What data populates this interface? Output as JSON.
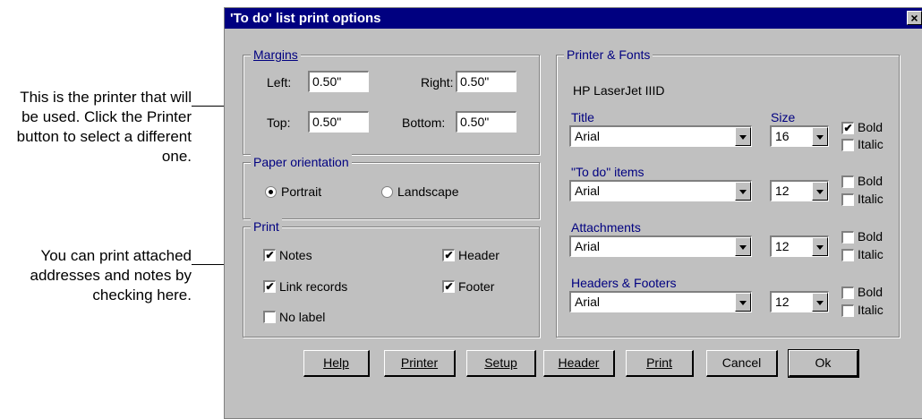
{
  "callouts": {
    "printer": "This is the printer that will be used. Click the Printer button to select a different one.",
    "attached": "You can print attached addresses and notes by checking here."
  },
  "dialog": {
    "title": "'To do' list print options",
    "close": "×"
  },
  "margins": {
    "legend": "Margins",
    "left_label": "Left:",
    "left_value": "0.50\"",
    "right_label": "Right:",
    "right_value": "0.50\"",
    "top_label": "Top:",
    "top_value": "0.50\"",
    "bottom_label": "Bottom:",
    "bottom_value": "0.50\""
  },
  "orientation": {
    "legend": "Paper orientation",
    "portrait": "Portrait",
    "portrait_selected": true,
    "landscape": "Landscape",
    "landscape_selected": false
  },
  "print": {
    "legend": "Print",
    "notes": "Notes",
    "notes_checked": true,
    "link_records": "Link records",
    "link_records_checked": true,
    "no_label": "No label",
    "no_label_checked": false,
    "header": "Header",
    "header_checked": true,
    "footer": "Footer",
    "footer_checked": true
  },
  "printer_fonts": {
    "legend": "Printer & Fonts",
    "printer_name": "HP LaserJet IIID",
    "size_label": "Size",
    "rows": [
      {
        "label": "Title",
        "font": "Arial",
        "size": "16",
        "bold": "Bold",
        "bold_checked": true,
        "italic": "Italic",
        "italic_checked": false
      },
      {
        "label": "\"To do\" items",
        "font": "Arial",
        "size": "12",
        "bold": "Bold",
        "bold_checked": false,
        "italic": "Italic",
        "italic_checked": false
      },
      {
        "label": "Attachments",
        "font": "Arial",
        "size": "12",
        "bold": "Bold",
        "bold_checked": false,
        "italic": "Italic",
        "italic_checked": false
      },
      {
        "label": "Headers & Footers",
        "font": "Arial",
        "size": "12",
        "bold": "Bold",
        "bold_checked": false,
        "italic": "Italic",
        "italic_checked": false
      }
    ]
  },
  "buttons": {
    "help": "Help",
    "printer": "Printer",
    "setup": "Setup",
    "header": "Header",
    "print": "Print",
    "cancel": "Cancel",
    "ok": "Ok"
  },
  "check_glyph": "✔"
}
